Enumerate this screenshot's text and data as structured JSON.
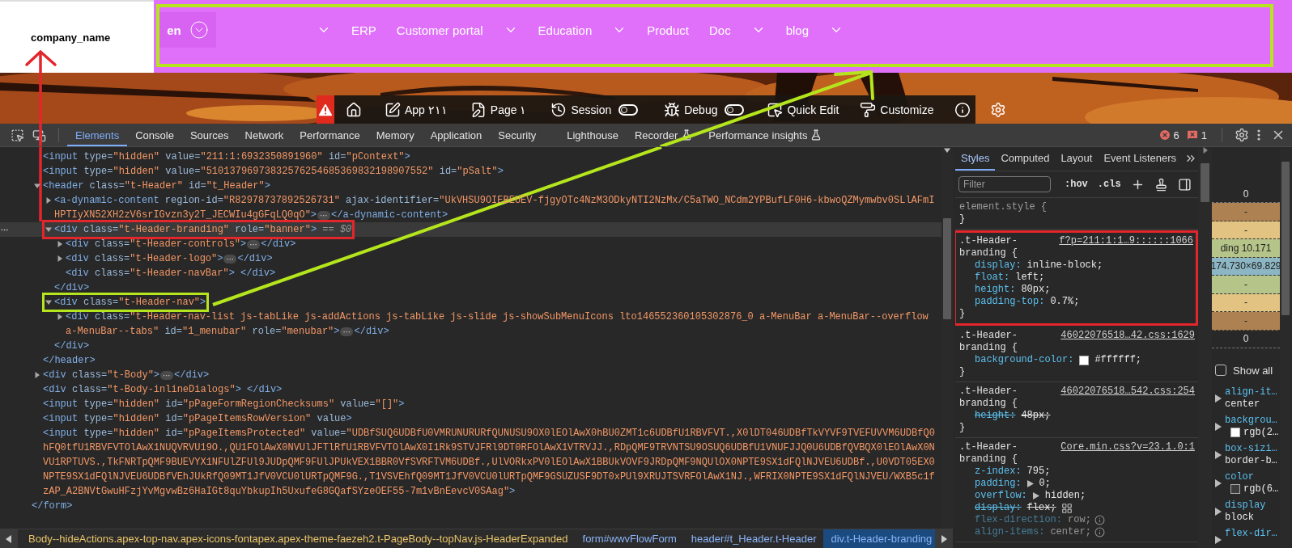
{
  "header": {
    "logo_text": "company_name",
    "language": "en",
    "color": "#b5e61d",
    "nav": [
      {
        "kind": "caret"
      },
      {
        "kind": "link",
        "label": "ERP"
      },
      {
        "kind": "link",
        "label": "Customer portal"
      },
      {
        "kind": "caret"
      },
      {
        "kind": "link",
        "label": "Education"
      },
      {
        "kind": "caret"
      },
      {
        "kind": "link",
        "label": "Product"
      },
      {
        "kind": "link",
        "label": "Doc"
      },
      {
        "kind": "caret"
      },
      {
        "kind": "link",
        "label": "blog"
      },
      {
        "kind": "caret"
      }
    ]
  },
  "dev_toolbar": [
    {
      "kind": "alert"
    },
    {
      "kind": "icon"
    },
    {
      "kind": "button",
      "label": "App ٢١١"
    },
    {
      "kind": "button",
      "label": "Page ١"
    },
    {
      "kind": "toggle",
      "label": "Session",
      "on": false
    },
    {
      "kind": "toggle",
      "label": "Debug",
      "on": false
    },
    {
      "kind": "button",
      "label": "Quick Edit"
    },
    {
      "kind": "button",
      "label": "Customize"
    },
    {
      "kind": "icon"
    },
    {
      "kind": "icon"
    }
  ],
  "devtools": {
    "tabs": [
      {
        "label": "Elements",
        "selected": true,
        "experimental": false
      },
      {
        "label": "Console",
        "selected": false,
        "experimental": false
      },
      {
        "label": "Sources",
        "selected": false,
        "experimental": false
      },
      {
        "label": "Network",
        "selected": false,
        "experimental": false
      },
      {
        "label": "Performance",
        "selected": false,
        "experimental": false
      },
      {
        "label": "Memory",
        "selected": false,
        "experimental": false
      },
      {
        "label": "Application",
        "selected": false,
        "experimental": false
      },
      {
        "label": "Security",
        "selected": false,
        "experimental": false
      },
      {
        "label": "Lighthouse",
        "selected": false,
        "experimental": false
      },
      {
        "label": "Recorder",
        "selected": false,
        "experimental": true
      },
      {
        "label": "Performance insights",
        "selected": false,
        "experimental": true
      }
    ],
    "error_count": "6",
    "issue_count": "1",
    "dom": {
      "children": [
        {
          "selected": false,
          "lines": [
            {
              "segments": [
                {
                  "kind": "tag",
                  "text": "<input"
                },
                {
                  "kind": "attr",
                  "text": " type="
                },
                {
                  "kind": "value",
                  "text": "\"hidden\""
                },
                {
                  "kind": "attr",
                  "text": " value="
                },
                {
                  "kind": "value",
                  "text": "\"211:1:6932350891960\""
                },
                {
                  "kind": "attr",
                  "text": " id="
                },
                {
                  "kind": "value",
                  "text": "\"pContext\""
                },
                {
                  "kind": "tag",
                  "text": ">"
                }
              ]
            }
          ]
        },
        {
          "selected": false,
          "lines": [
            {
              "segments": [
                {
                  "kind": "tag",
                  "text": "<input"
                },
                {
                  "kind": "attr",
                  "text": " type="
                },
                {
                  "kind": "value",
                  "text": "\"hidden\""
                },
                {
                  "kind": "attr",
                  "text": " value="
                },
                {
                  "kind": "value",
                  "text": "\"51013796973832576254685369832198907552\""
                },
                {
                  "kind": "attr",
                  "text": " id="
                },
                {
                  "kind": "value",
                  "text": "\"pSalt\""
                },
                {
                  "kind": "tag",
                  "text": ">"
                }
              ]
            }
          ]
        },
        {
          "selected": false,
          "expanded": true,
          "lines": [
            {
              "segments": [
                {
                  "kind": "tag",
                  "text": "<header"
                },
                {
                  "kind": "attr",
                  "text": " class="
                },
                {
                  "kind": "value",
                  "text": "\"t-Header\""
                },
                {
                  "kind": "attr",
                  "text": " id="
                },
                {
                  "kind": "value",
                  "text": "\"t_Header\""
                },
                {
                  "kind": "tag",
                  "text": ">"
                }
              ]
            }
          ],
          "children": [
            {
              "selected": false,
              "expanded": false,
              "lines": [
                {
                  "segments": [
                    {
                      "kind": "tag",
                      "text": "<a-dynamic-content"
                    },
                    {
                      "kind": "attr",
                      "text": " region-id="
                    },
                    {
                      "kind": "value",
                      "text": "\"R82978737892526731\""
                    },
                    {
                      "kind": "attr",
                      "text": " ajax-identifier="
                    },
                    {
                      "kind": "value",
                      "text": "\"UkVHSU9OIEBEUEV-fjgyOTc4NzM3ODkyNTI2NzMx/C5aTWO_NCdm2YPBufLF0H6-kbwoQZMymwbv0SLlAFmI"
                    }
                  ]
                },
                {
                  "segments": [
                    {
                      "kind": "value",
                      "text": "HPTIyXN52XH2zV6srIGvzn3y2T_JECWIu4gGFqLQ0qO\""
                    },
                    {
                      "kind": "tag",
                      "text": ">"
                    },
                    {
                      "kind": "ellipsis",
                      "text": "⋯"
                    },
                    {
                      "kind": "tag",
                      "text": "</a-dynamic-content>"
                    }
                  ]
                }
              ]
            },
            {
              "selected": true,
              "expanded": true,
              "color": "#e3262b",
              "lines": [
                {
                  "segments": [
                    {
                      "kind": "tag",
                      "text": "<div"
                    },
                    {
                      "kind": "attr",
                      "text": " class="
                    },
                    {
                      "kind": "value",
                      "text": "\"t-Header-branding\""
                    },
                    {
                      "kind": "attr",
                      "text": " role="
                    },
                    {
                      "kind": "value",
                      "text": "\"banner\""
                    },
                    {
                      "kind": "tag",
                      "text": ">"
                    },
                    {
                      "kind": "marker",
                      "text": " == $0"
                    }
                  ]
                }
              ],
              "children": [
                {
                  "selected": false,
                  "expanded": false,
                  "lines": [
                    {
                      "segments": [
                        {
                          "kind": "tag",
                          "text": "<div"
                        },
                        {
                          "kind": "attr",
                          "text": " class="
                        },
                        {
                          "kind": "value",
                          "text": "\"t-Header-controls\""
                        },
                        {
                          "kind": "tag",
                          "text": ">"
                        },
                        {
                          "kind": "ellipsis",
                          "text": "⋯"
                        },
                        {
                          "kind": "tag",
                          "text": "</div>"
                        }
                      ]
                    }
                  ]
                },
                {
                  "selected": false,
                  "expanded": false,
                  "lines": [
                    {
                      "segments": [
                        {
                          "kind": "tag",
                          "text": "<div"
                        },
                        {
                          "kind": "attr",
                          "text": " class="
                        },
                        {
                          "kind": "value",
                          "text": "\"t-Header-logo\""
                        },
                        {
                          "kind": "tag",
                          "text": ">"
                        },
                        {
                          "kind": "ellipsis",
                          "text": "⋯"
                        },
                        {
                          "kind": "tag",
                          "text": "</div>"
                        }
                      ]
                    }
                  ]
                },
                {
                  "selected": false,
                  "lines": [
                    {
                      "segments": [
                        {
                          "kind": "tag",
                          "text": "<div"
                        },
                        {
                          "kind": "attr",
                          "text": " class="
                        },
                        {
                          "kind": "value",
                          "text": "\"t-Header-navBar\""
                        },
                        {
                          "kind": "tag",
                          "text": "> </div>"
                        }
                      ]
                    }
                  ]
                }
              ],
              "closing": [
                {
                  "kind": "tag",
                  "text": "</div>"
                }
              ]
            },
            {
              "selected": false,
              "expanded": true,
              "color": "#b5e61d",
              "lines": [
                {
                  "segments": [
                    {
                      "kind": "tag",
                      "text": "<div"
                    },
                    {
                      "kind": "attr",
                      "text": " class="
                    },
                    {
                      "kind": "value",
                      "text": "\"t-Header-nav\""
                    },
                    {
                      "kind": "tag",
                      "text": ">"
                    }
                  ]
                }
              ],
              "children": [
                {
                  "selected": false,
                  "expanded": false,
                  "lines": [
                    {
                      "segments": [
                        {
                          "kind": "tag",
                          "text": "<div"
                        },
                        {
                          "kind": "attr",
                          "text": " class="
                        },
                        {
                          "kind": "value",
                          "text": "\"t-Header-nav-list js-tabLike js-addActions js-tabLike js-slide js-showSubMenuIcons lto146552360105302876_0 a-MenuBar a-MenuBar--overflow"
                        }
                      ]
                    },
                    {
                      "segments": [
                        {
                          "kind": "value",
                          "text": "a-MenuBar--tabs\""
                        },
                        {
                          "kind": "attr",
                          "text": " id="
                        },
                        {
                          "kind": "value",
                          "text": "\"1_menubar\""
                        },
                        {
                          "kind": "attr",
                          "text": " role="
                        },
                        {
                          "kind": "value",
                          "text": "\"menubar\""
                        },
                        {
                          "kind": "tag",
                          "text": ">"
                        },
                        {
                          "kind": "ellipsis",
                          "text": "⋯"
                        },
                        {
                          "kind": "tag",
                          "text": "</div>"
                        }
                      ]
                    }
                  ]
                }
              ],
              "closing": [
                {
                  "kind": "tag",
                  "text": "</div>"
                }
              ]
            }
          ],
          "closing": [
            {
              "kind": "tag",
              "text": "</header>"
            }
          ]
        },
        {
          "selected": false,
          "expanded": false,
          "lines": [
            {
              "segments": [
                {
                  "kind": "tag",
                  "text": "<div"
                },
                {
                  "kind": "attr",
                  "text": " class="
                },
                {
                  "kind": "value",
                  "text": "\"t-Body\""
                },
                {
                  "kind": "tag",
                  "text": ">"
                },
                {
                  "kind": "ellipsis",
                  "text": "⋯"
                },
                {
                  "kind": "tag",
                  "text": "</div>"
                }
              ]
            }
          ]
        },
        {
          "selected": false,
          "lines": [
            {
              "segments": [
                {
                  "kind": "tag",
                  "text": "<div"
                },
                {
                  "kind": "attr",
                  "text": " class="
                },
                {
                  "kind": "value",
                  "text": "\"t-Body-inlineDialogs\""
                },
                {
                  "kind": "tag",
                  "text": "> </div>"
                }
              ]
            }
          ]
        },
        {
          "selected": false,
          "lines": [
            {
              "segments": [
                {
                  "kind": "tag",
                  "text": "<input"
                },
                {
                  "kind": "attr",
                  "text": " type="
                },
                {
                  "kind": "value",
                  "text": "\"hidden\""
                },
                {
                  "kind": "attr",
                  "text": " id="
                },
                {
                  "kind": "value",
                  "text": "\"pPageFormRegionChecksums\""
                },
                {
                  "kind": "attr",
                  "text": " value="
                },
                {
                  "kind": "value",
                  "text": "\"[]\""
                },
                {
                  "kind": "tag",
                  "text": ">"
                }
              ]
            }
          ]
        },
        {
          "selected": false,
          "lines": [
            {
              "segments": [
                {
                  "kind": "tag",
                  "text": "<input"
                },
                {
                  "kind": "attr",
                  "text": " type="
                },
                {
                  "kind": "value",
                  "text": "\"hidden\""
                },
                {
                  "kind": "attr",
                  "text": " id="
                },
                {
                  "kind": "value",
                  "text": "\"pPageItemsRowVersion\""
                },
                {
                  "kind": "attr",
                  "text": " value"
                },
                {
                  "kind": "tag",
                  "text": ">"
                }
              ]
            }
          ]
        },
        {
          "selected": false,
          "lines": [
            {
              "segments": [
                {
                  "kind": "tag",
                  "text": "<input"
                },
                {
                  "kind": "attr",
                  "text": " type="
                },
                {
                  "kind": "value",
                  "text": "\"hidden\""
                },
                {
                  "kind": "attr",
                  "text": " id="
                },
                {
                  "kind": "value",
                  "text": "\"pPageItemsProtected\""
                },
                {
                  "kind": "attr",
                  "text": " value="
                },
                {
                  "kind": "value",
                  "text": "\"UDBfSUQ6UDBfU0VMRUNURURfQUNUSU9OX0lEOlAwX0hBU0ZMT1c6UDBfU1RBVFVT.,X0lDT046UDBfTkVYVF9TVEFUVVM6UDBfQ0"
                }
              ]
            },
            {
              "segments": [
                {
                  "kind": "value",
                  "text": "hFQ0tfU1RBVFVTOlAwX1NUQVRVU19O.,QU1FOlAwX0NVUlJFTlRfU1RBVFVTOlAwX0I1Rk9STVJFRl9DT0RFOlAwX1VTRVJJ.,RDpQMF9TRVNTSU9OSUQ6UDBfU1VNUFJJQ0U6UDBfQVBQX0lEOlAwX0N"
                }
              ]
            },
            {
              "segments": [
                {
                  "kind": "value",
                  "text": "VU1RPTUVS.,TkFNRTpQMF9BUEVYX1NFUlZFUl9JUDpQMF9FUlJPUkVEX1BBR0VfSVRFTVM6UDBf.,UlVORkxPV0lEOlAwX1BBUkVOVF9JRDpQMF9NQUlOX0NPTE9SX1dFQlNJVEU6UDBf.,U0VDT05EX0"
                }
              ]
            },
            {
              "segments": [
                {
                  "kind": "value",
                  "text": "NPTE9SX1dFQlNJVEU6UDBfVEhJUkRfQ09MT1JfV0VCU0lURTpQMF9G.,T1VSVEhfQ09MT1JfV0VCU0lURTpQMF9GSUZUSF9DT0xPUl9XRUJTSVRFOlAwX1NJ.,WFRIX0NPTE9SX1dFQlNJVEU/WXB5c1f"
                }
              ]
            },
            {
              "segments": [
                {
                  "kind": "value",
                  "text": "zAP_A2BNVtGwuHFzjYvMgvwBz6HaIGt8quYbkupIh5UxufeG8GQafSYzeOEF55-7m1vBnEevcV0SAag\""
                },
                {
                  "kind": "tag",
                  "text": ">"
                }
              ]
            }
          ]
        }
      ],
      "closing": [
        {
          "kind": "tag",
          "text": "</form>"
        }
      ]
    },
    "breadcrumbs": [
      {
        "kind": "class",
        "text": "Body--hideActions.apex-top-nav.apex-icons-fontapex.apex-theme-faezeh2.t-PageBody--topNav.js-HeaderExpanded",
        "selected": false
      },
      {
        "kind": "element",
        "text": "form#wwvFlowForm",
        "selected": false
      },
      {
        "kind": "element",
        "text": "header#t_Header.t-Header",
        "selected": false
      },
      {
        "kind": "element",
        "text": "div.t-Header-branding",
        "selected": true
      }
    ],
    "styles": {
      "tabs": [
        {
          "label": "Styles",
          "selected": true
        },
        {
          "label": "Computed",
          "selected": false
        },
        {
          "label": "Layout",
          "selected": false
        },
        {
          "label": "Event Listeners",
          "selected": false
        }
      ],
      "filter_placeholder": "Filter",
      "hov": ":hov",
      "cls": ".cls",
      "rules": [
        {
          "selector": "element.style {",
          "close": "}"
        },
        {
          "selector": ".t-Header-branding {",
          "source": "f?p=211:1:1…9::::::1066",
          "color": "#e3262b",
          "close": "}",
          "declarations": [
            {
              "property": "display:",
              "value": "inline-block;",
              "struck": false,
              "inactive": false,
              "expandable": false,
              "grid_editor": false
            },
            {
              "property": "float:",
              "value": "left;",
              "struck": false,
              "inactive": false,
              "expandable": false,
              "grid_editor": false
            },
            {
              "property": "height:",
              "value": "80px;",
              "struck": false,
              "inactive": false,
              "expandable": false,
              "grid_editor": false
            },
            {
              "property": "padding-top:",
              "value": "0.7%;",
              "struck": false,
              "inactive": false,
              "expandable": false,
              "grid_editor": false
            }
          ]
        },
        {
          "selector": ".t-Header-branding {",
          "source": "46022076518…42.css:1629",
          "close": "}",
          "declarations": [
            {
              "property": "background-color:",
              "value": "#ffffff;",
              "color": "#ffffff",
              "struck": false,
              "inactive": false,
              "expandable": false,
              "grid_editor": false
            }
          ]
        },
        {
          "selector": ".t-Header-branding {",
          "source": "46022076518…542.css:254",
          "close": "}",
          "declarations": [
            {
              "property": "height:",
              "value": "48px;",
              "struck": true,
              "inactive": false,
              "expandable": false,
              "grid_editor": false
            }
          ]
        },
        {
          "selector": ".t-Header-branding {",
          "source": "Core.min.css?v=23.1.0:1",
          "declarations": [
            {
              "property": "z-index:",
              "value": "795;",
              "struck": false,
              "inactive": false,
              "expandable": false,
              "grid_editor": false
            },
            {
              "property": "padding:",
              "value": "0;",
              "struck": false,
              "inactive": false,
              "expandable": true,
              "grid_editor": false
            },
            {
              "property": "overflow:",
              "value": "hidden;",
              "struck": false,
              "inactive": false,
              "expandable": true,
              "grid_editor": false
            },
            {
              "property": "display:",
              "value": "flex;",
              "struck": true,
              "inactive": false,
              "expandable": false,
              "grid_editor": true
            },
            {
              "property": "flex-direction:",
              "value": "row;",
              "struck": false,
              "inactive": true,
              "expandable": false,
              "grid_editor": false
            },
            {
              "property": "align-items:",
              "value": "center;",
              "struck": false,
              "inactive": true,
              "expandable": false,
              "grid_editor": false
            }
          ]
        }
      ]
    },
    "box_model": [
      {
        "kind": "position",
        "text": "0"
      },
      {
        "kind": "margin",
        "text": "-"
      },
      {
        "kind": "border",
        "text": "-"
      },
      {
        "kind": "padding",
        "text": "ding 10.171"
      },
      {
        "kind": "content",
        "text": "174.730×69.829"
      },
      {
        "kind": "padding",
        "text": "-"
      },
      {
        "kind": "border",
        "text": "-"
      },
      {
        "kind": "margin",
        "text": "-"
      },
      {
        "kind": "position",
        "text": "0"
      }
    ],
    "show_all": {
      "label": "Show all",
      "checked": false
    },
    "computed": [
      {
        "property": "align-it…",
        "value": "center"
      },
      {
        "property": "backgrou…",
        "value": "rgb(2…",
        "color": "#ffffff"
      },
      {
        "property": "box-sizi…",
        "value": "border-b…"
      },
      {
        "property": "color",
        "value": "rgb(6…",
        "color": "#3c3c3c"
      },
      {
        "property": "display",
        "value": "block"
      },
      {
        "property": "flex-dir…"
      }
    ]
  }
}
